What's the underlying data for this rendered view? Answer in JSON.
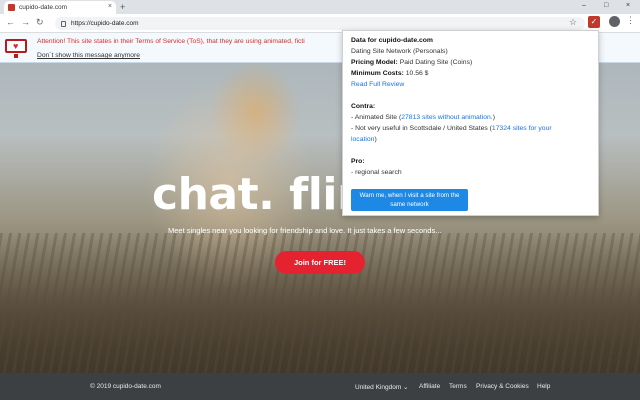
{
  "browser": {
    "tab_title": "cupido-date.com",
    "url": "https://cupido-date.com",
    "new_tab": "+",
    "close_tab": "×",
    "window_minimize": "–",
    "window_maximize": "□",
    "window_close": "×"
  },
  "notice": {
    "text": "Attention! This site states in their Terms of Service (ToS), that they are using animated, ficti",
    "dismiss": "Don´t show this message anymore"
  },
  "hero": {
    "headline": "chat. flir",
    "subtitle": "Meet singles near you looking for friendship and love. It just takes a few seconds...",
    "cta": "Join for FREE!"
  },
  "footer": {
    "copyright": "© 2019 cupido-date.com",
    "region": "United Kingdom",
    "links": [
      "Affiliate",
      "Terms",
      "Privacy & Cookies",
      "Help"
    ]
  },
  "popup": {
    "title_prefix": "Data for",
    "domain": "cupido-date.com",
    "network": "Dating Site Network (Personals)",
    "pricing_label": "Pricing Model:",
    "pricing_value": "Paid Dating Site (Coins)",
    "cost_label": "Minimum Costs:",
    "cost_value": "10.56 $",
    "read_review": "Read Full Review",
    "contra_heading": "Contra:",
    "contra1_prefix": "- Animated Site (",
    "contra1_link": "27813 sites without animation.",
    "contra1_suffix": ")",
    "contra2_prefix": "- Not very useful in Scottsdale / United States (",
    "contra2_link_a": "17324 sites for your",
    "contra2_link_b": "location",
    "contra2_suffix": ")",
    "pro_heading": "Pro:",
    "pro1": "- regional search",
    "warn_button_line1": "Warn me, when I visit a site from the",
    "warn_button_line2": "same network"
  },
  "colors": {
    "notice_text": "#d32f2f",
    "cta": "#e52330",
    "link": "#1a73e8",
    "warn_button": "#1e88e5",
    "footer": "#3c4043"
  }
}
